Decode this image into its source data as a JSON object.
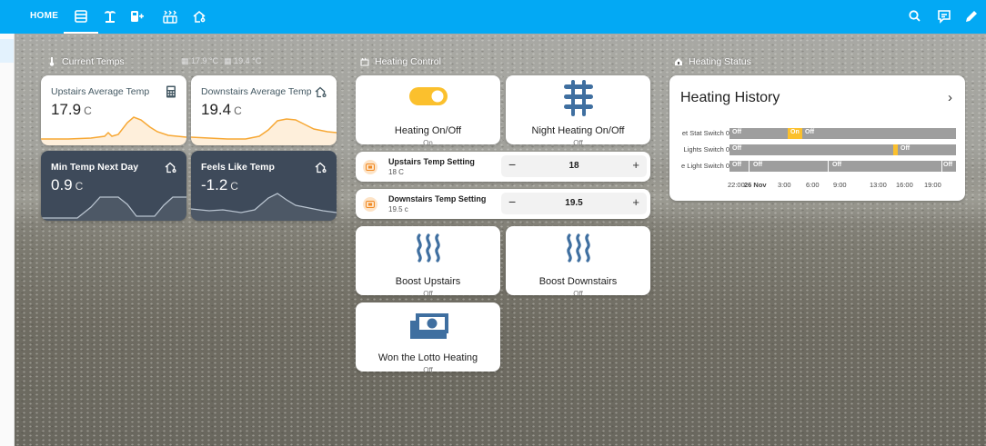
{
  "topbar": {
    "home_label": "HOME",
    "tab_icons": [
      "radiator-icon",
      "palm-tree-icon",
      "heat-pump-icon",
      "radiator-off-icon",
      "home-thermometer-icon"
    ],
    "right_icons": [
      "search-icon",
      "assist-icon",
      "edit-icon"
    ]
  },
  "current_temps": {
    "title": "Current Temps",
    "badges": [
      "17.9 °C",
      "19.4 °C"
    ],
    "cards": [
      {
        "name": "Upstairs Average Temp",
        "value": "17.9",
        "unit": "C",
        "icon": "calculator-icon"
      },
      {
        "name": "Downstairs Average Temp",
        "value": "19.4",
        "unit": "C",
        "icon": "home-thermometer-icon"
      },
      {
        "name": "Min Temp Next Day",
        "value": "0.9",
        "unit": "C",
        "icon": "home-thermometer-icon"
      },
      {
        "name": "Feels Like Temp",
        "value": "-1.2",
        "unit": "C",
        "icon": "home-thermometer-icon"
      }
    ]
  },
  "heating_control": {
    "title": "Heating Control",
    "heating_onoff": {
      "label": "Heating On/Off",
      "state": "On"
    },
    "night_heating": {
      "label": "Night Heating On/Off",
      "state": "Off"
    },
    "upstairs_setting": {
      "name": "Upstairs Temp Setting",
      "current": "18 C",
      "value": "18"
    },
    "downstairs_setting": {
      "name": "Downstairs Temp Setting",
      "current": "19.5 c",
      "value": "19.5"
    },
    "boost_upstairs": {
      "label": "Boost Upstairs",
      "state": "Off"
    },
    "boost_downstairs": {
      "label": "Boost Downstairs",
      "state": "Off"
    },
    "lotto": {
      "label": "Won the Lotto Heating",
      "state": "Off"
    }
  },
  "heating_status": {
    "title": "Heating Status",
    "card_title": "Heating History",
    "rows": [
      {
        "label": "et Stat Switch 0",
        "segments": [
          {
            "text": "Off",
            "color": "#9e9e9e"
          },
          {
            "text": "On",
            "color": "#fbc02d"
          },
          {
            "text": "Off",
            "color": "#9e9e9e"
          }
        ]
      },
      {
        "label": "Lights Switch 0",
        "segments": [
          {
            "text": "Off",
            "color": "#9e9e9e"
          },
          {
            "text": "",
            "color": "#fbc02d"
          },
          {
            "text": "Off",
            "color": "#9e9e9e"
          }
        ]
      },
      {
        "label": "e Light Switch 0",
        "segments": [
          {
            "text": "Off",
            "color": "#9e9e9e"
          },
          {
            "text": "Off",
            "color": "#9e9e9e"
          },
          {
            "text": "Off",
            "color": "#9e9e9e"
          },
          {
            "text": "Off",
            "color": "#9e9e9e"
          }
        ]
      }
    ],
    "axis": [
      "22:00",
      "26 Nov",
      "3:00",
      "6:00",
      "9:00",
      "13:00",
      "16:00",
      "19:00"
    ]
  },
  "colors": {
    "accent": "#03a9f4",
    "graph_orange": "#f7a835",
    "dark_card": "#3e4a5a",
    "toggle_on": "#fbc02d",
    "icon_blue": "#3f6fa0"
  }
}
